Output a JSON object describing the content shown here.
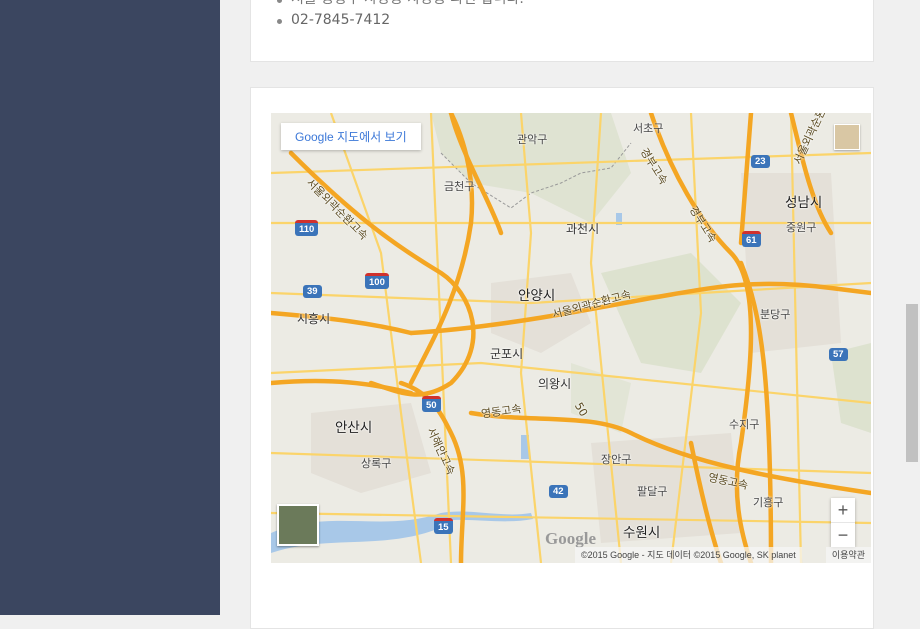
{
  "info_card": {
    "address_line": "서울 중랑구 사당동 사당동 파편 합니다.",
    "phone": "02-7845-7412"
  },
  "map": {
    "open_in_maps_label": "Google 지도에서 보기",
    "zoom_in_label": "+",
    "zoom_out_label": "−",
    "logo_text": "Google",
    "copyright": "©2015 Google - 지도 데이터 ©2015 Google, SK planet",
    "terms": "이용약관",
    "places": {
      "seongnam": "성남시",
      "anyang": "안양시",
      "gunpo": "군포시",
      "uiwang": "의왕시",
      "siheung": "시흥시",
      "ansan": "안산시",
      "suwon": "수원시",
      "gwacheon": "과천시",
      "geumcheon": "금천구",
      "gwanak": "관악구",
      "seocho": "서초구",
      "jungwon": "중원구",
      "bundang": "분당구",
      "suji": "수지구",
      "jangan": "장안구",
      "paldal": "팔달구",
      "giheung": "기흥구",
      "sangnok": "상록구"
    },
    "roads": {
      "ring_nw": "서울외곽순환고속",
      "ring_center": "서울외곽순환고속",
      "yeongdong_w": "영동고속",
      "yeongdong_e": "영동고속",
      "seohaean": "서해안고속",
      "gyeongbu": "경부고속",
      "gyeongbu_n": "경부고속",
      "ring_ne": "서울외곽순환"
    },
    "shields": [
      "110",
      "100",
      "39",
      "50",
      "42",
      "15",
      "23",
      "61",
      "57"
    ],
    "route_50_label": "50"
  },
  "colors": {
    "sidebar": "#3b4660",
    "highway": "#f4a623",
    "road": "#fbd46a",
    "land": "#ecebe4",
    "water": "#a8c8e8",
    "shield": "#3b74b9"
  }
}
